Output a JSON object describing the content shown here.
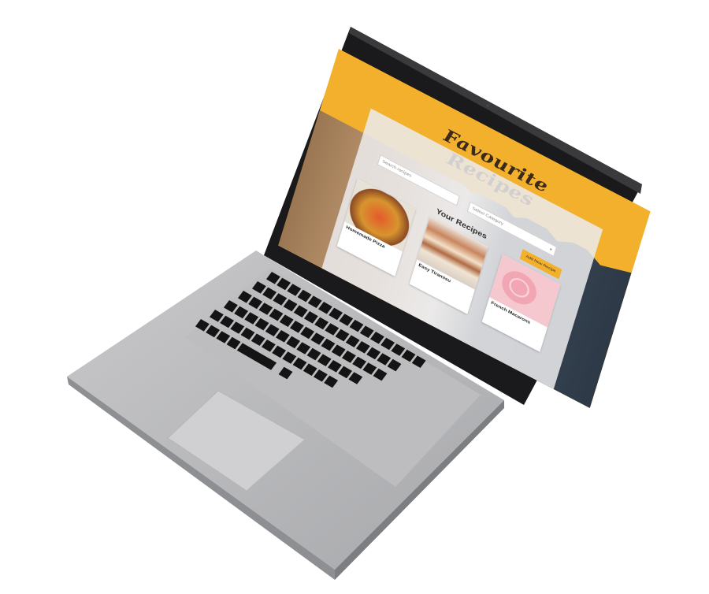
{
  "app": {
    "title": "Favourite Recipes"
  },
  "toolbar": {
    "search_placeholder": "Search recipes",
    "category_placeholder": "Select Category",
    "add_button_label": "Add New Recipe"
  },
  "main": {
    "section_title": "Your Recipes",
    "recipes": [
      {
        "name": "Homemade Pizza"
      },
      {
        "name": "Easy Tiramisu"
      },
      {
        "name": "French Macarons"
      }
    ]
  },
  "colors": {
    "accent": "#f3b02c",
    "title_text": "#3a2a1a",
    "panel": "#ebebee"
  },
  "icons": {
    "select_arrow": "chevron-down-icon"
  }
}
